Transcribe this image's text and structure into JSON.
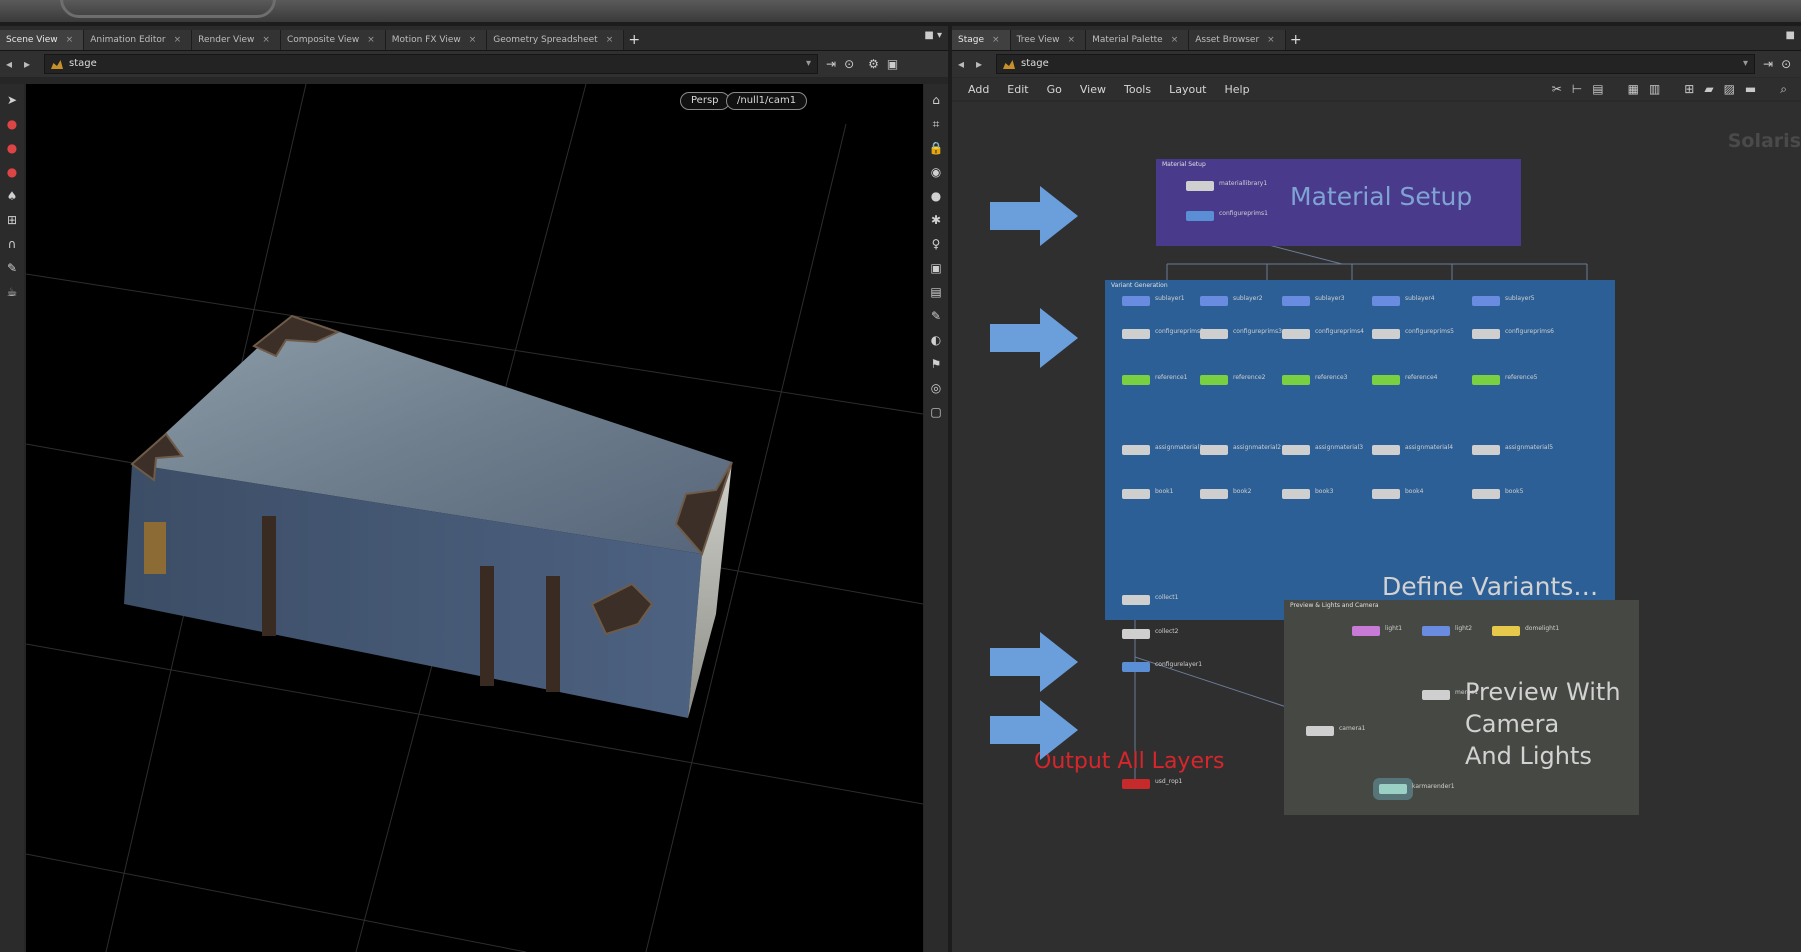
{
  "left_pane": {
    "tabs": [
      {
        "label": "Scene View",
        "active": true
      },
      {
        "label": "Animation Editor"
      },
      {
        "label": "Render View"
      },
      {
        "label": "Composite View"
      },
      {
        "label": "Motion FX View"
      },
      {
        "label": "Geometry Spreadsheet"
      }
    ],
    "add_tab": "+",
    "path": "stage",
    "viewport": {
      "persp_label": "Persp",
      "camera_label": "/null1/cam1"
    }
  },
  "right_pane": {
    "tabs": [
      {
        "label": "Stage",
        "active": true
      },
      {
        "label": "Tree View"
      },
      {
        "label": "Material Palette"
      },
      {
        "label": "Asset Browser"
      }
    ],
    "add_tab": "+",
    "path": "stage",
    "menu": [
      "Add",
      "Edit",
      "Go",
      "View",
      "Tools",
      "Layout",
      "Help"
    ],
    "watermark": "Solaris",
    "network": {
      "material_box": {
        "title": "Material Setup",
        "label": "Material Setup"
      },
      "variant_box": {
        "title": "Variant Generation",
        "label": "Define Variants…"
      },
      "preview_box": {
        "title": "Preview & Lights and Camera",
        "label_lines": [
          "Preview With",
          "Camera",
          "And Lights"
        ]
      },
      "output_label": "Output All Layers",
      "nodes": {
        "material_library": "materiallibrary1",
        "configure_prim": "configureprims1",
        "sublayers": [
          "sublayer1",
          "sublayer2",
          "sublayer3",
          "sublayer4",
          "sublayer5"
        ],
        "configs": [
          "configureprims2",
          "configureprims3",
          "configureprims4",
          "configureprims5",
          "configureprims6"
        ],
        "references": [
          "reference1",
          "reference2",
          "reference3",
          "reference4",
          "reference5"
        ],
        "assigns": [
          "assignmaterial1",
          "assignmaterial2",
          "assignmaterial3",
          "assignmaterial4",
          "assignmaterial5"
        ],
        "nulls": [
          "book1",
          "book2",
          "book3",
          "book4",
          "book5"
        ],
        "collect": "collect1",
        "collect2": "collect2",
        "configure_layer": "configurelayer1",
        "rop": "usd_rop1",
        "lights": [
          "light1",
          "light2",
          "domelight1"
        ],
        "merge": "merge1",
        "camera": "camera1",
        "karma": "karmarender1"
      }
    }
  },
  "colors": {
    "arrow_fill": "#6b9fdc",
    "material_box": "#4a3a8c",
    "variant_box": "#2c5f96",
    "preview_box": "#464843",
    "label_blue": "#7fa4d4",
    "label_light": "#d2d2d2",
    "output_red": "#d7262b"
  }
}
